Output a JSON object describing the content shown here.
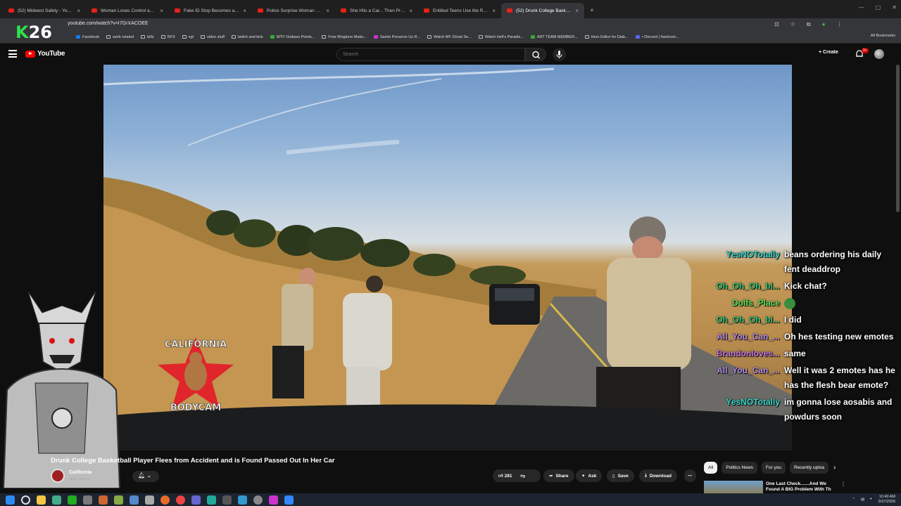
{
  "browser": {
    "tabs": [
      {
        "label": "(52) Midwest Safety - YouTube",
        "active": false
      },
      {
        "label": "Woman Loses Control and Cau",
        "active": false
      },
      {
        "label": "Fake ID Stop Becomes a Full-Bl",
        "active": false
      },
      {
        "label": "Police Surprise Woman Carryin",
        "active": false
      },
      {
        "label": "She Hits a Car... Then Pretends",
        "active": false
      },
      {
        "label": "Entitled Teens Use the Race Ca",
        "active": false
      },
      {
        "label": "(52) Drunk College Basketb",
        "active": true
      }
    ],
    "new_tab": "+",
    "url": "youtube.com/watch?v=I7GrXACOEE",
    "bookmarks": [
      "Facebook",
      "work related",
      "bills",
      "RFS",
      "egl",
      "video stuff",
      "twitch and kick",
      "WTF Outlaws Points...",
      "Free Ringtone Make...",
      "Saints Preserve Us R...",
      "Watch MF Ghost Se...",
      "Watch Hell's Paradis...",
      "ART TEAM MEMBER...",
      "Hero Editor for Diab...",
      "• Discord | #welcom..."
    ],
    "all_bookmarks": "All Bookmarks"
  },
  "overlay": {
    "k_letter": "K",
    "k_number": "26",
    "chat": [
      {
        "user": "YesNOTotally",
        "color": "#37d7c8",
        "msg": "beans ordering his daily fent deaddrop"
      },
      {
        "user": "Oh_Oh_Oh_bl...",
        "color": "#34c87a",
        "msg": "Kick chat?"
      },
      {
        "user": "Dolfs_Place",
        "color": "#5fe35a",
        "msg": ""
      },
      {
        "user": "Oh_Oh_Oh_bl...",
        "color": "#34c87a",
        "msg": "I did"
      },
      {
        "user": "All_You_Can_...",
        "color": "#b98ee8",
        "msg": "Oh hes testing new emotes"
      },
      {
        "user": "Brandonloves...",
        "color": "#c47ae0",
        "msg": "same"
      },
      {
        "user": "All_You_Can_...",
        "color": "#b98ee8",
        "msg": "Well it was 2 emotes has he has the flesh bear emote?"
      },
      {
        "user": "YesNOTotally",
        "color": "#37d7c8",
        "msg": "im gonna lose aosabis and powdurs soon"
      }
    ],
    "logo_top": "CALIFORNIA",
    "logo_bottom": "BODYCAM"
  },
  "youtube": {
    "logo": "YouTube",
    "search_placeholder": "Search",
    "create": "Create",
    "notif_badge": "9+",
    "video_title": "Drunk College Basketball Player Flees from Accident and is Found Passed Out In Her Car",
    "channel": "California",
    "subs": "361K subscri",
    "likes": "281",
    "share": "Share",
    "ask": "Ask",
    "save": "Save",
    "download": "Download",
    "chips": [
      "All",
      "Politics News",
      "For you",
      "Recently uploa"
    ],
    "rec_title": "One Last Check.......And We Found A BIG Problem With Th"
  },
  "taskbar": {
    "time": "10:40 AM",
    "date": "3/27/2026"
  }
}
